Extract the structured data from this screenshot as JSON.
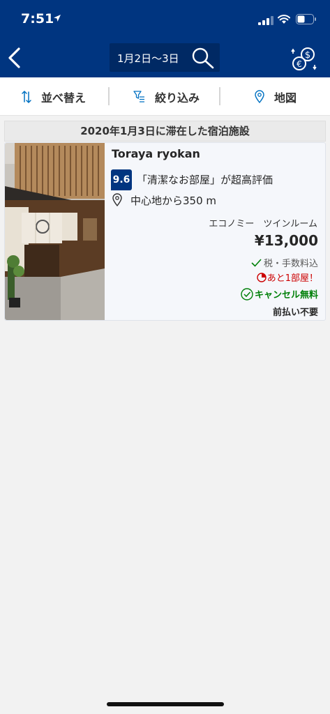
{
  "status_bar": {
    "time": "7:51"
  },
  "header": {
    "date_range": "1月2日〜3日",
    "back_icon": "chevron-left-icon",
    "search_icon": "search-icon",
    "currency_icon": "currency-exchange-icon",
    "background_color": "#003580"
  },
  "toolbar": {
    "sort_label": "並べ替え",
    "filter_label": "絞り込み",
    "map_label": "地図"
  },
  "results": {
    "section_title": "2020年1月3日に滞在した宿泊施設",
    "hotels": [
      {
        "name": "Toraya ryokan",
        "score": "9.6",
        "review_highlight": "「清潔なお部屋」が超高評価",
        "distance": "中心地から350 m",
        "room_type": "エコノミー　ツインルーム",
        "price": "¥13,000",
        "tax_note": "税・手数料込",
        "rooms_left": "あと1部屋！",
        "free_cancellation": "キャンセル無料",
        "no_prepayment": "前払い不要"
      }
    ]
  },
  "colors": {
    "brand": "#003580",
    "accent_blue": "#0071c2",
    "urgent_red": "#cc0000",
    "positive_green": "#008009"
  }
}
